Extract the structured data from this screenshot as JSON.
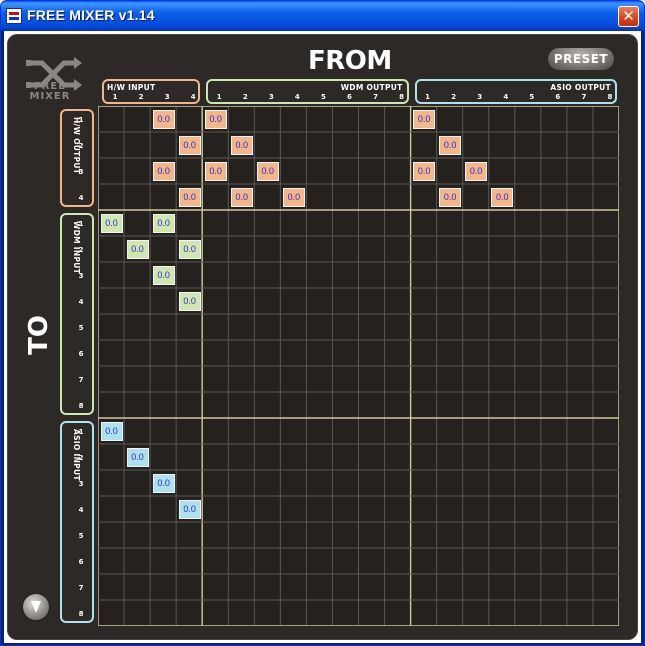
{
  "window": {
    "title": "FREE MIXER v1.14",
    "close": "✕"
  },
  "app": {
    "logo_text": [
      "FREE",
      "MIXER"
    ],
    "from_label": "FROM",
    "to_label": "TO",
    "preset_label": "PRESET"
  },
  "colors": {
    "hw": "#f3b58a",
    "wdm": "#cfe6b0",
    "asio": "#aee0ee",
    "grid_line": "#5a5753",
    "group_line": "#cfc99a",
    "panel": "#2c2926",
    "cell_text": "#2a2ad0"
  },
  "columns": [
    {
      "label": "H/W INPUT",
      "count": 4,
      "key": "hw"
    },
    {
      "label": "WDM OUTPUT",
      "count": 8,
      "key": "wdm"
    },
    {
      "label": "ASIO OUTPUT",
      "count": 8,
      "key": "asio"
    }
  ],
  "rows": [
    {
      "label": "H/W OUTPUT",
      "count": 4,
      "key": "hw"
    },
    {
      "label": "WDM INPUT",
      "count": 8,
      "key": "wdm"
    },
    {
      "label": "ASIO INPUT",
      "count": 8,
      "key": "asio"
    }
  ],
  "cells": [
    {
      "row": 0,
      "col": 2,
      "value": "0.0",
      "key": "hw"
    },
    {
      "row": 0,
      "col": 4,
      "value": "0.0",
      "key": "hw"
    },
    {
      "row": 0,
      "col": 12,
      "value": "0.0",
      "key": "hw"
    },
    {
      "row": 1,
      "col": 3,
      "value": "0.0",
      "key": "hw"
    },
    {
      "row": 1,
      "col": 5,
      "value": "0.0",
      "key": "hw"
    },
    {
      "row": 1,
      "col": 13,
      "value": "0.0",
      "key": "hw"
    },
    {
      "row": 2,
      "col": 2,
      "value": "0.0",
      "key": "hw"
    },
    {
      "row": 2,
      "col": 4,
      "value": "0.0",
      "key": "hw"
    },
    {
      "row": 2,
      "col": 6,
      "value": "0.0",
      "key": "hw"
    },
    {
      "row": 2,
      "col": 12,
      "value": "0.0",
      "key": "hw"
    },
    {
      "row": 2,
      "col": 14,
      "value": "0.0",
      "key": "hw"
    },
    {
      "row": 3,
      "col": 3,
      "value": "0.0",
      "key": "hw"
    },
    {
      "row": 3,
      "col": 5,
      "value": "0.0",
      "key": "hw"
    },
    {
      "row": 3,
      "col": 7,
      "value": "0.0",
      "key": "hw"
    },
    {
      "row": 3,
      "col": 13,
      "value": "0.0",
      "key": "hw"
    },
    {
      "row": 3,
      "col": 15,
      "value": "0.0",
      "key": "hw"
    },
    {
      "row": 4,
      "col": 0,
      "value": "0.0",
      "key": "wdm"
    },
    {
      "row": 4,
      "col": 2,
      "value": "0.0",
      "key": "wdm"
    },
    {
      "row": 5,
      "col": 1,
      "value": "0.0",
      "key": "wdm"
    },
    {
      "row": 5,
      "col": 3,
      "value": "0.0",
      "key": "wdm"
    },
    {
      "row": 6,
      "col": 2,
      "value": "0.0",
      "key": "wdm"
    },
    {
      "row": 7,
      "col": 3,
      "value": "0.0",
      "key": "wdm"
    },
    {
      "row": 12,
      "col": 0,
      "value": "0.0",
      "key": "asio"
    },
    {
      "row": 13,
      "col": 1,
      "value": "0.0",
      "key": "asio"
    },
    {
      "row": 14,
      "col": 2,
      "value": "0.0",
      "key": "asio"
    },
    {
      "row": 15,
      "col": 3,
      "value": "0.0",
      "key": "asio"
    }
  ]
}
